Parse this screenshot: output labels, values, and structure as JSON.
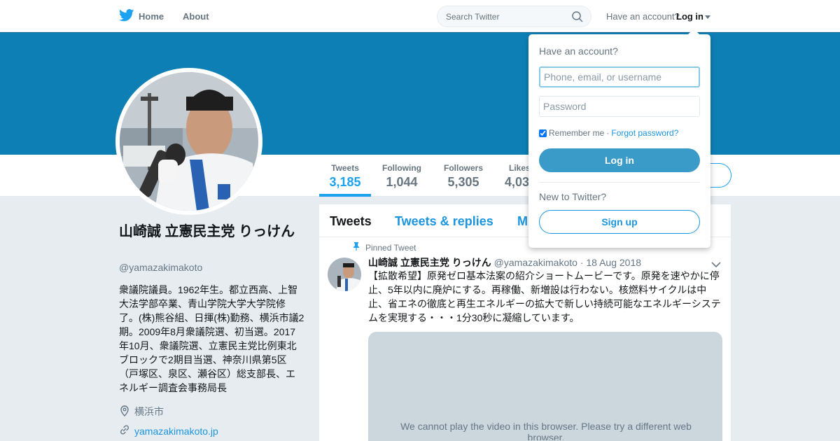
{
  "colors": {
    "accent": "#1da1f2",
    "banner": "#0d7fb5",
    "link": "#1b95e0"
  },
  "nav": {
    "home_label": "Home",
    "about_label": "About",
    "search_placeholder": "Search Twitter",
    "have_account": "Have an account?",
    "login_label": "Log in"
  },
  "profile": {
    "name": "山崎誠 立憲民主党 りっけん",
    "handle": "@yamazakimakoto",
    "bio": "衆議院議員。1962年生。都立西高、上智大法学部卒業、青山学院大学大学院修了。(株)熊谷組、日揮(株)勤務、横浜市議2期。2009年8月衆議院選、初当選。2017年10月、衆議院選、立憲民主党比例東北ブロックで2期目当選、神奈川県第5区（戸塚区、泉区、瀬谷区）総支部長、エネルギー調査会事務局長",
    "location": "横浜市",
    "url": "yamazakimakoto.jp"
  },
  "stats": [
    {
      "label": "Tweets",
      "value": "3,185"
    },
    {
      "label": "Following",
      "value": "1,044"
    },
    {
      "label": "Followers",
      "value": "5,305"
    },
    {
      "label": "Likes",
      "value": "4,03"
    }
  ],
  "timeline": {
    "tabs": [
      "Tweets",
      "Tweets & replies",
      "M"
    ],
    "pinned_label": "Pinned Tweet",
    "tweet": {
      "name": "山崎誠 立憲民主党 りっけん",
      "handle": "@yamazakimakoto",
      "date": "· 18 Aug 2018",
      "text": "【拡散希望】原発ゼロ基本法案の紹介ショートムービーです。原発を速やかに停止、5年以内に廃炉にする。再稼働、新増設は行わない。核燃料サイクルは中止、省エネの徹底と再生エネルギーの拡大で新しい持続可能なエネルギーシステムを実現する・・・1分30秒に凝縮しています。",
      "video_message": "We cannot play the video in this browser. Please try a different web browser."
    }
  },
  "login_dropdown": {
    "title": "Have an account?",
    "username_placeholder": "Phone, email, or username",
    "password_placeholder": "Password",
    "remember_label": "Remember me",
    "separator": "·",
    "forgot_label": "Forgot password?",
    "login_button": "Log in",
    "new_label": "New to Twitter?",
    "signup_button": "Sign up"
  }
}
